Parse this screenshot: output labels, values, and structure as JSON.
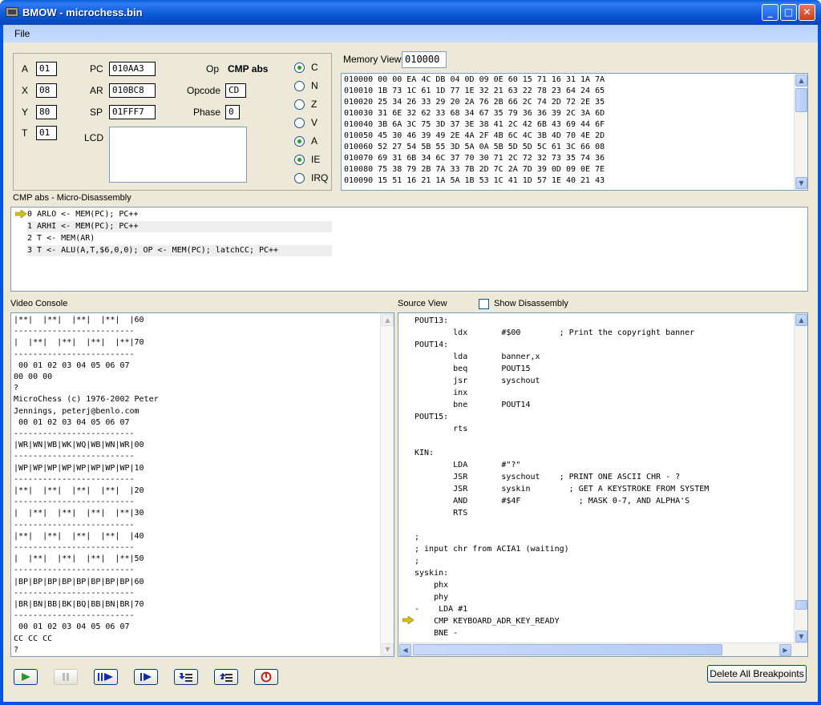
{
  "window": {
    "title": "BMOW - microchess.bin"
  },
  "menu": {
    "file": "File"
  },
  "registers": {
    "A": {
      "label": "A",
      "value": "01"
    },
    "X": {
      "label": "X",
      "value": "08"
    },
    "Y": {
      "label": "Y",
      "value": "80"
    },
    "T": {
      "label": "T",
      "value": "01"
    },
    "PC": {
      "label": "PC",
      "value": "010AA3"
    },
    "AR": {
      "label": "AR",
      "value": "010BC8"
    },
    "SP": {
      "label": "SP",
      "value": "01FFF7"
    },
    "op": {
      "label": "Op",
      "value": "CMP abs"
    },
    "opcode": {
      "label": "Opcode",
      "value": "CD"
    },
    "phase": {
      "label": "Phase",
      "value": "0"
    },
    "lcd": {
      "label": "LCD"
    }
  },
  "flags": [
    {
      "label": "C",
      "checked": true
    },
    {
      "label": "N",
      "checked": false
    },
    {
      "label": "Z",
      "checked": false
    },
    {
      "label": "V",
      "checked": false
    },
    {
      "label": "A",
      "checked": true
    },
    {
      "label": "IE",
      "checked": true
    },
    {
      "label": "IRQ",
      "checked": false
    }
  ],
  "memory": {
    "label": "Memory View",
    "address": "010000",
    "lines": [
      "010000 00 00 EA 4C DB 04 0D 09 0E 60 15 71 16 31 1A 7A",
      "010010 1B 73 1C 61 1D 77 1E 32 21 63 22 78 23 64 24 65",
      "010020 25 34 26 33 29 20 2A 76 2B 66 2C 74 2D 72 2E 35",
      "010030 31 6E 32 62 33 68 34 67 35 79 36 36 39 2C 3A 6D",
      "010040 3B 6A 3C 75 3D 37 3E 38 41 2C 42 6B 43 69 44 6F",
      "010050 45 30 46 39 49 2E 4A 2F 4B 6C 4C 3B 4D 70 4E 2D",
      "010060 52 27 54 5B 55 3D 5A 0A 5B 5D 5D 5C 61 3C 66 08",
      "010070 69 31 6B 34 6C 37 70 30 71 2C 72 32 73 35 74 36",
      "010080 75 38 79 2B 7A 33 7B 2D 7C 2A 7D 39 0D 09 0E 7E",
      "010090 15 51 16 21 1A 5A 1B 53 1C 41 1D 57 1E 40 21 43"
    ]
  },
  "micro": {
    "label": "CMP abs - Micro-Disassembly",
    "lines": [
      "0 ARLO <- MEM(PC); PC++",
      "1 ARHI <- MEM(PC); PC++",
      "2 T <- MEM(AR)",
      "3 T <- ALU(A,T,$6,0,0); OP <- MEM(PC); latchCC; PC++"
    ]
  },
  "console": {
    "label": "Video Console",
    "text": "|**|  |**|  |**|  |**|  |60\n-------------------------\n|  |**|  |**|  |**|  |**|70\n-------------------------\n 00 01 02 03 04 05 06 07\n00 00 00\n?\nMicroChess (c) 1976-2002 Peter\nJennings, peterj@benlo.com\n 00 01 02 03 04 05 06 07\n-------------------------\n|WR|WN|WB|WK|WQ|WB|WN|WR|00\n-------------------------\n|WP|WP|WP|WP|WP|WP|WP|WP|10\n-------------------------\n|**|  |**|  |**|  |**|  |20\n-------------------------\n|  |**|  |**|  |**|  |**|30\n-------------------------\n|**|  |**|  |**|  |**|  |40\n-------------------------\n|  |**|  |**|  |**|  |**|50\n-------------------------\n|BP|BP|BP|BP|BP|BP|BP|BP|60\n-------------------------\n|BR|BN|BB|BK|BQ|BB|BN|BR|70\n-------------------------\n 00 01 02 03 04 05 06 07\nCC CC CC\n?"
  },
  "source": {
    "label": "Source View",
    "show_disassembly": "Show Disassembly",
    "text": "POUT13:\n        ldx       #$00        ; Print the copyright banner\nPOUT14:\n        lda       banner,x\n        beq       POUT15\n        jsr       syschout\n        inx\n        bne       POUT14\nPOUT15:\n        rts\n\nKIN:\n        LDA       #\"?\"\n        JSR       syschout    ; PRINT ONE ASCII CHR - ?\n        JSR       syskin        ; GET A KEYSTROKE FROM SYSTEM\n        AND       #$4F            ; MASK 0-7, AND ALPHA'S\n        RTS\n\n;\n; input chr from ACIA1 (waiting)\n;\nsyskin:\n    phx\n    phy\n-    LDA #1\n    CMP KEYBOARD_ADR_KEY_READY\n    BNE -\n    LDA KEYBOARD_ADR_KEY_BUFFER"
  },
  "toolbar": {
    "delete_breakpoints": "Delete All Breakpoints"
  },
  "colors": {
    "accent": "#0054e3",
    "arrow": "#d4c017",
    "flag_dot": "#21a121"
  }
}
